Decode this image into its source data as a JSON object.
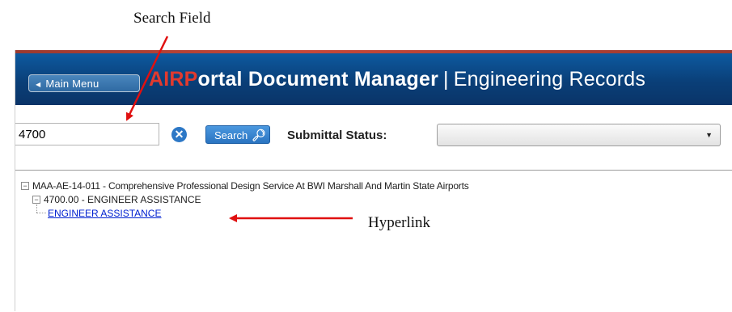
{
  "callouts": {
    "search_field": "Search Field",
    "hyperlink": "Hyperlink"
  },
  "header": {
    "main_menu_label": "Main Menu",
    "main_menu_icon": "triangle-left-icon",
    "title_accent": "AIRP",
    "title_main": "ortal Document Manager",
    "title_divider": "|",
    "title_sub": "Engineering Records",
    "colors": {
      "bar": "#0a3f78",
      "accent": "#e23a2e"
    }
  },
  "toolbar": {
    "search_value": "4700",
    "clear_icon": "x-circle-icon",
    "search_label": "Search",
    "search_icon": "magnifier-icon",
    "status_label": "Submittal Status:",
    "status_value": ""
  },
  "tree": {
    "root": "MAA-AE-14-011 - Comprehensive Professional Design Service At BWI Marshall And Martin State Airports",
    "child": "4700.00 - ENGINEER ASSISTANCE",
    "leaf": "ENGINEER ASSISTANCE",
    "toggle_symbol": "−"
  }
}
